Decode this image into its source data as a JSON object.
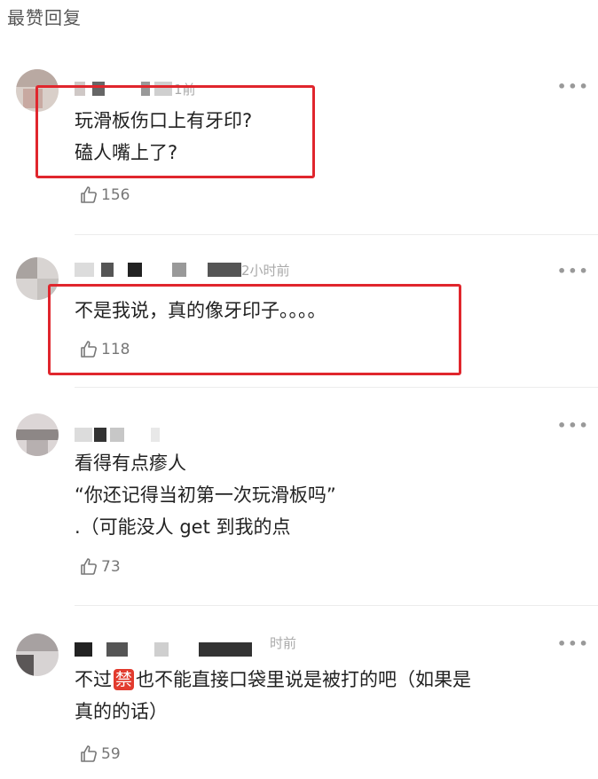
{
  "section": {
    "title": "最赞回复"
  },
  "comments": [
    {
      "time": "1前",
      "lines": [
        "玩滑板伤口上有牙印?",
        "磕人嘴上了?"
      ],
      "likes": "156"
    },
    {
      "time": "2小时前",
      "lines": [
        "不是我说，真的像牙印子。。。。"
      ],
      "likes": "118"
    },
    {
      "time": "",
      "lines": [
        "看得有点瘆人",
        "“你还记得当初第一次玩滑板吗”",
        ".（可能没人 get 到我的点"
      ],
      "likes": "73"
    },
    {
      "time": "时前",
      "line1_before": "不过",
      "line1_badge": "禁",
      "line1_after": "也不能直接口袋里说是被打的吧（如果是",
      "line2": "真的的话）",
      "likes": "59"
    }
  ],
  "more_symbol": "•••",
  "icons": {
    "like": "thumbs-up-icon",
    "more": "more-dots-icon"
  },
  "colors": {
    "highlight": "#e0262d",
    "badge": "#e23b2e"
  }
}
